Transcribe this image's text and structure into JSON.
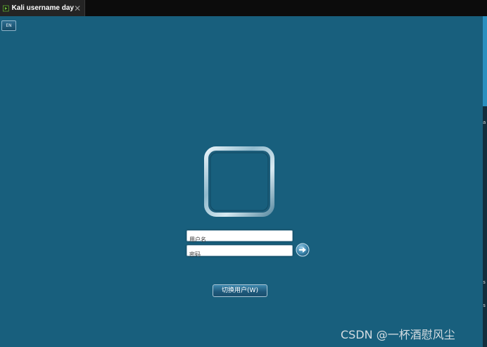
{
  "tab": {
    "title": "Kali username day",
    "close_glyph": "✕",
    "icon": "terminal-play-icon"
  },
  "login": {
    "language_button": "EN",
    "username_placeholder": "用户名",
    "password_placeholder": "密码",
    "login_icon": "arrow-right-icon",
    "switch_user_label": "切换用户(W)"
  },
  "edge_chars": [
    "a",
    "s",
    "s"
  ],
  "watermark": "CSDN @一杯酒慰风尘",
  "colors": {
    "background": "#185f7d",
    "tabbar": "#0c0c0c",
    "accent": "#2a8fbf"
  }
}
